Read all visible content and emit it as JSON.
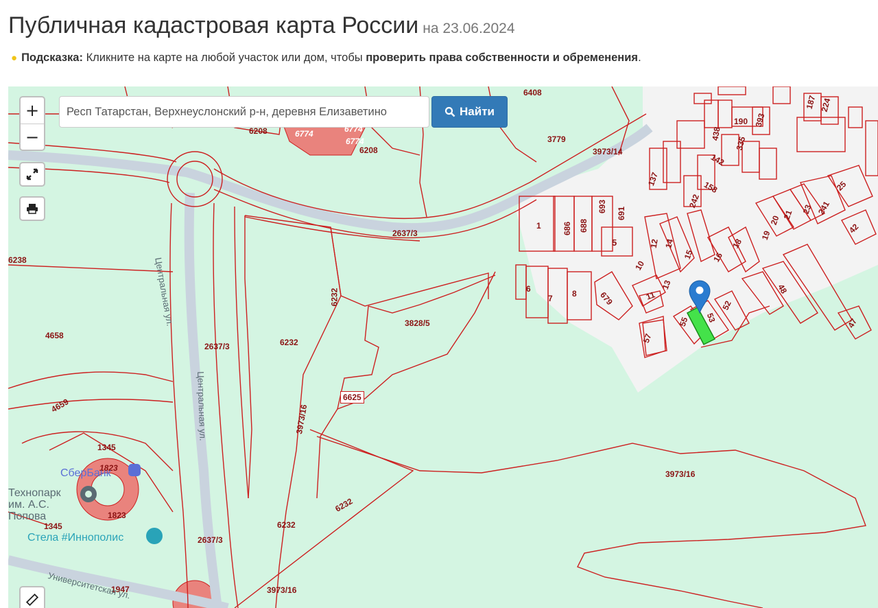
{
  "header": {
    "title": "Публичная кадастровая карта России",
    "date": "на 23.06.2024"
  },
  "hint": {
    "label": "Подсказка:",
    "text_before": " Кликните на карте на любой участок или дом, чтобы ",
    "emphasis": "проверить права собственности и обременения",
    "text_after": "."
  },
  "controls": {
    "zoom_in": "+",
    "zoom_out": "−",
    "search_value": "Респ Татарстан, Верхнеуслонский р-н, деревня Елизаветино",
    "find_label": "Найти",
    "icons": [
      "search-icon",
      "fullscreen-icon",
      "print-icon",
      "ruler-icon",
      "map-marker-icon",
      "lightbulb-icon"
    ]
  },
  "map": {
    "colors": {
      "background": "#d4f5e2",
      "parcel_line": "#cc2020",
      "built_zone": "#f2f2f2",
      "selected_parcel": "#44e24a",
      "marker": "#2a7cd0"
    },
    "parcel_labels": [
      "6408",
      "6774",
      "6774",
      "6774",
      "6208",
      "6208",
      "3779",
      "3973/14",
      "2637/3",
      "6232",
      "3828/5",
      "6625",
      "3973/16",
      "6232",
      "2637/3",
      "6232",
      "4658",
      "6238",
      "4659",
      "1345",
      "1823",
      "1823",
      "1345",
      "2637/3",
      "6232",
      "3973/16",
      "3973/16",
      "1947",
      "1",
      "686",
      "688",
      "693",
      "691",
      "5",
      "6",
      "7",
      "8",
      "679",
      "10",
      "11",
      "12",
      "13",
      "14",
      "15",
      "16",
      "18",
      "19",
      "20",
      "21",
      "23",
      "241",
      "25",
      "42",
      "48",
      "47",
      "52",
      "53",
      "55",
      "57",
      "137",
      "142",
      "158",
      "242",
      "438",
      "335",
      "190",
      "393",
      "187",
      "224"
    ],
    "streets": [
      "Центральная ул.",
      "Центральная ул.",
      "Университетская ул."
    ],
    "pois": [
      "СберБанк",
      "Технопарк им. А.С. Попова",
      "Стела #Иннополис"
    ]
  }
}
